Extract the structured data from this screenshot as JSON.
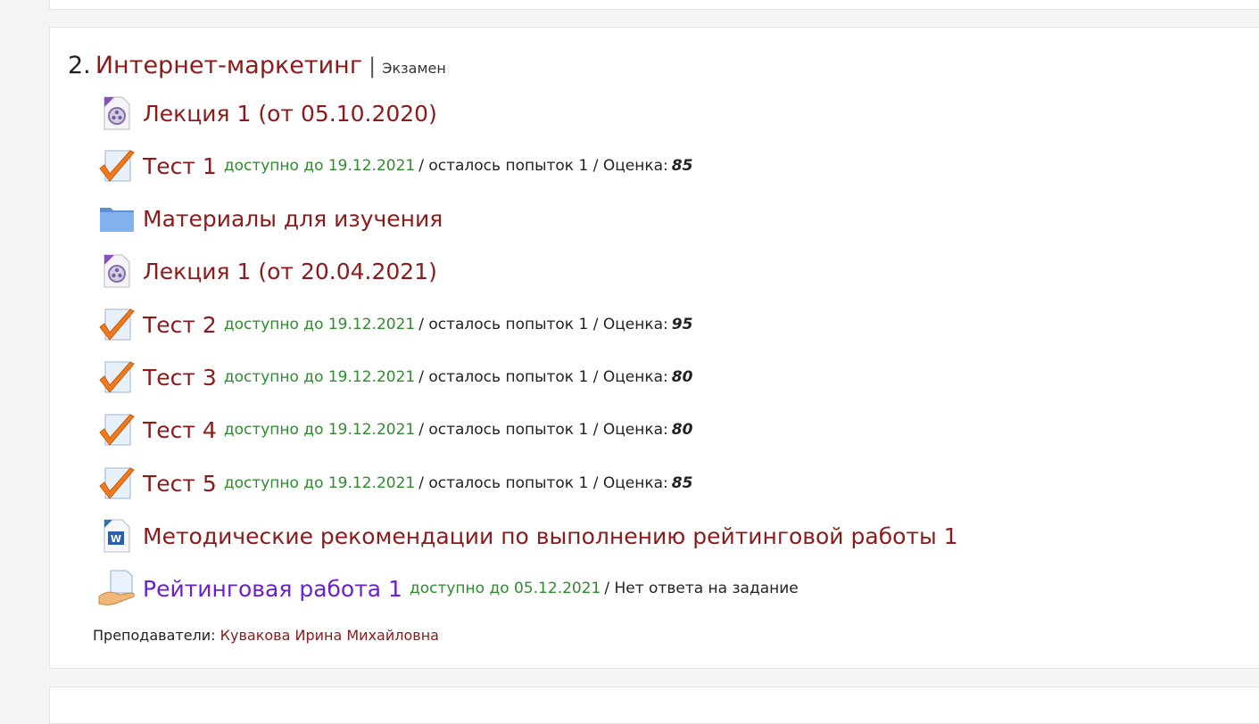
{
  "course": {
    "number": "2.",
    "title": "Интернет-маркетинг",
    "separator": "|",
    "exam_label": "Экзамен"
  },
  "activities": [
    {
      "icon": "video-lecture-icon",
      "name": "Лекция 1 (от 05.10.2020)"
    },
    {
      "icon": "quiz-check-icon",
      "name": "Тест 1",
      "availability": "доступно до 19.12.2021",
      "attempts": "/ осталось попыток 1 / Оценка:",
      "grade": "85"
    },
    {
      "icon": "folder-icon",
      "name": "Материалы для изучения"
    },
    {
      "icon": "video-lecture-icon",
      "name": "Лекция 1 (от 20.04.2021)"
    },
    {
      "icon": "quiz-check-icon",
      "name": "Тест 2",
      "availability": "доступно до 19.12.2021",
      "attempts": "/ осталось попыток 1 / Оценка:",
      "grade": "95"
    },
    {
      "icon": "quiz-check-icon",
      "name": "Тест 3",
      "availability": "доступно до 19.12.2021",
      "attempts": "/ осталось попыток 1 / Оценка:",
      "grade": "80"
    },
    {
      "icon": "quiz-check-icon",
      "name": "Тест 4",
      "availability": "доступно до 19.12.2021",
      "attempts": "/ осталось попыток 1 / Оценка:",
      "grade": "80"
    },
    {
      "icon": "quiz-check-icon",
      "name": "Тест 5",
      "availability": "доступно до 19.12.2021",
      "attempts": "/ осталось попыток 1 / Оценка:",
      "grade": "85"
    },
    {
      "icon": "word-document-icon",
      "name": "Методические рекомендации по выполнению рейтинговой работы 1"
    },
    {
      "icon": "assignment-hand-icon",
      "name": "Рейтинговая работа 1",
      "availability": "доступно до 05.12.2021",
      "status": "/ Нет ответа на задание"
    }
  ],
  "teachers": {
    "label": "Преподаватели:",
    "name": "Кувакова Ирина Михайловна"
  },
  "colors": {
    "link": "#8b1a1a",
    "visited_link": "#6a1fd0",
    "availability": "#2e8b2e",
    "card_border": "#e4e4e4"
  }
}
